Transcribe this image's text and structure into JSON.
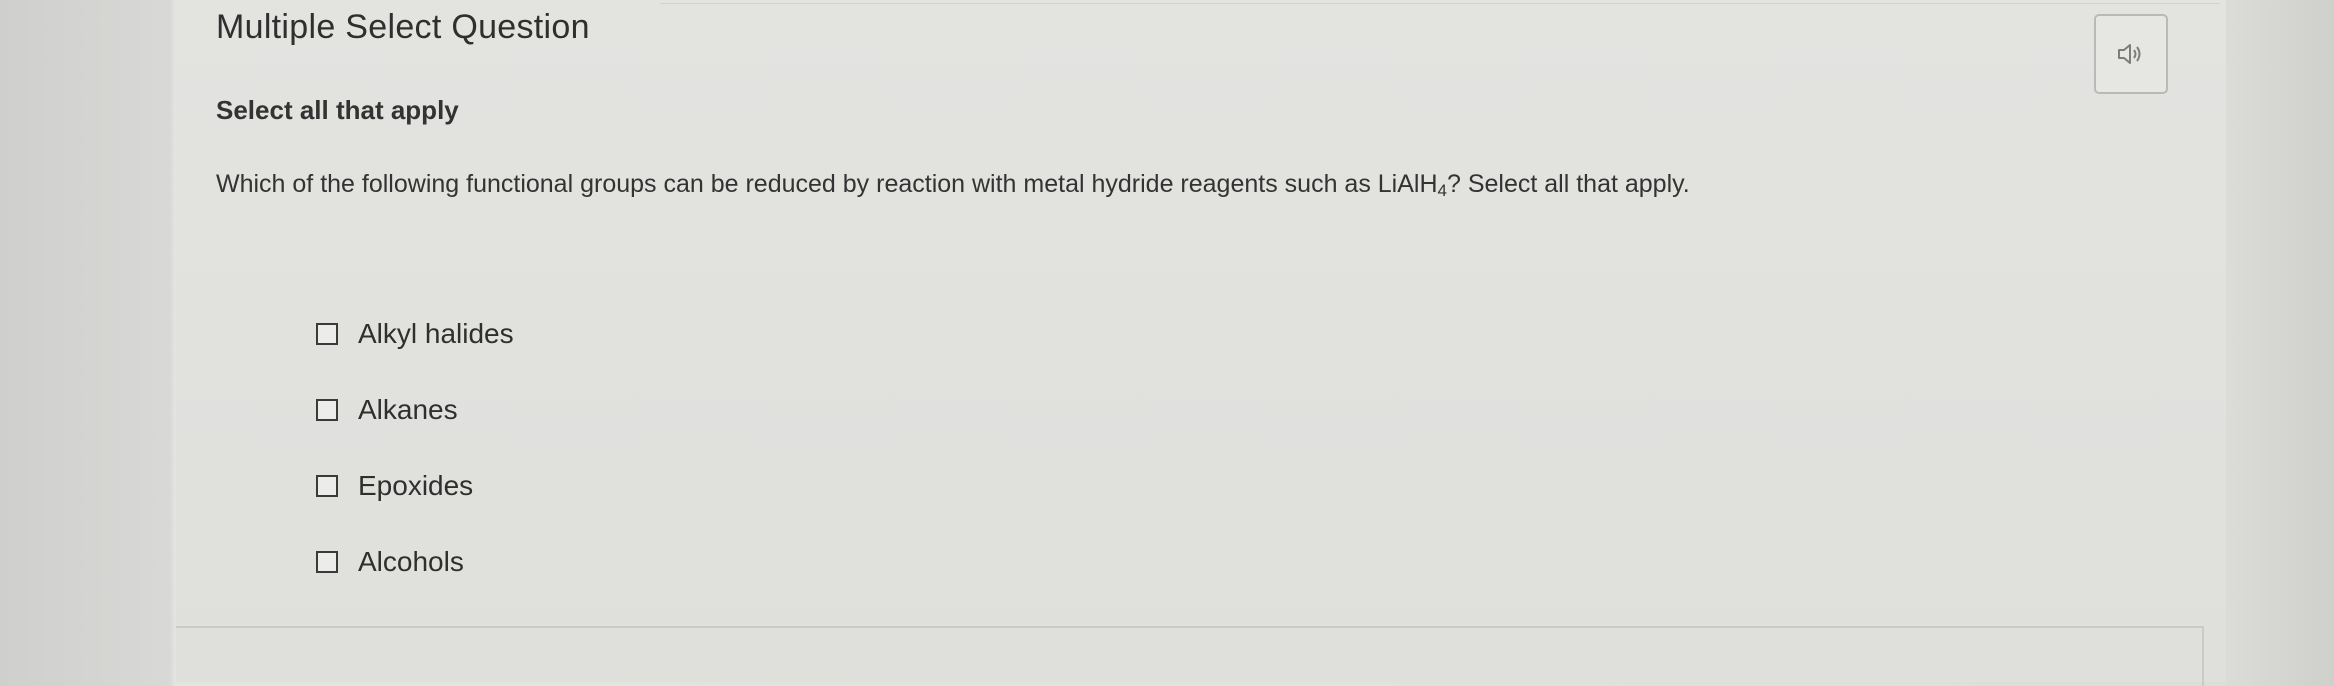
{
  "question": {
    "title": "Multiple Select Question",
    "instruction": "Select all that apply",
    "prompt_before": "Which of the following functional groups can be reduced by reaction with metal hydride reagents such as LiAlH",
    "prompt_subscript": "4",
    "prompt_after": "? Select all that apply."
  },
  "audio_button": {
    "icon": "speaker-icon"
  },
  "options": [
    {
      "label": "Alkyl halides",
      "checked": false
    },
    {
      "label": "Alkanes",
      "checked": false
    },
    {
      "label": "Epoxides",
      "checked": false
    },
    {
      "label": "Alcohols",
      "checked": false
    }
  ]
}
